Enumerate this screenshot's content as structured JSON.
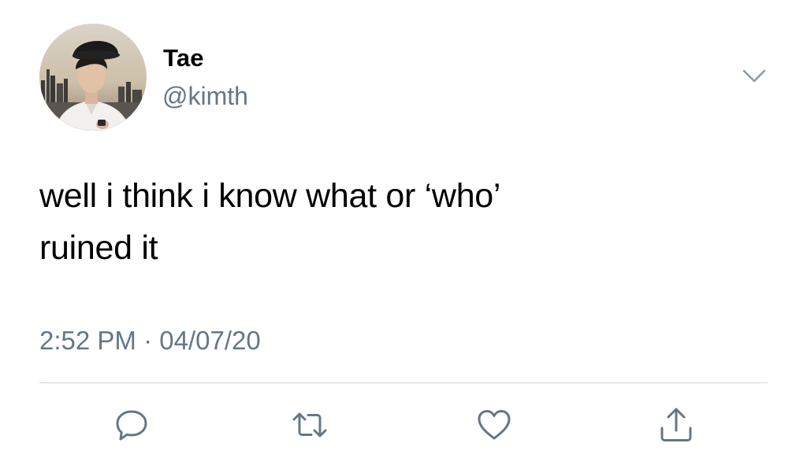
{
  "tweet": {
    "display_name": "Tae",
    "handle": "@kimth",
    "text_line1": "well i think i know what or ‘who’",
    "text_line2": "ruined it",
    "time": "2:52 PM",
    "separator": "·",
    "date": "04/07/20"
  },
  "icons": {
    "menu": "chevron-down-icon",
    "reply": "reply-icon",
    "retweet": "retweet-icon",
    "like": "heart-icon",
    "share": "share-icon"
  },
  "colors": {
    "text": "#000000",
    "secondary_text": "#657786",
    "icon": "#657786",
    "divider": "#d4d4d4"
  }
}
